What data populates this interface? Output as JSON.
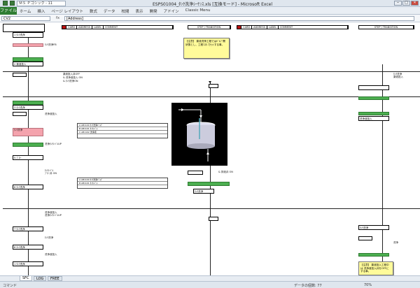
{
  "window": {
    "title": "ESPS01004_ﾀﾝｸ洗浄ｼｰｹﾝｽ.xls [互換モード] - Microsoft Excel",
    "font_box": "ＭＳ Ｐゴシック - 11",
    "controls": [
      "‒",
      "□",
      "✕"
    ]
  },
  "ribbon": {
    "file_label": "ファイル",
    "tabs": [
      "ホーム",
      "挿入",
      "ページ レイアウト",
      "数式",
      "データ",
      "校閲",
      "表示",
      "開発",
      "アドイン",
      "Classic Menu"
    ]
  },
  "formula_bar": {
    "name_box": "CV2",
    "fx": "fx",
    "formula": "[Address]"
  },
  "sheet": {
    "left_header": [
      "CARD",
      "ADDRESS",
      "LABEL",
      "COMMENT"
    ],
    "left_right_header": "STEP / TRANSITION",
    "right_header": [
      "CARD",
      "ADDRESS",
      "LABEL",
      "COMMENT"
    ],
    "right_right_header": "STEP / TRANSITION",
    "rows": [
      {
        "step": "1",
        "label": "ﾀﾝｸ洗浄"
      },
      {
        "step": "2",
        "label": "薬液投入"
      },
      {
        "step": "3",
        "label": "ﾀﾝｸ洗浄"
      },
      {
        "step": "4",
        "label": "ﾀﾝｸ洗浄"
      },
      {
        "step": "5",
        "label": "ﾌﾞﾛｰ"
      },
      {
        "step": "6",
        "label": "ﾀﾝｸ洗浄"
      },
      {
        "step": "7",
        "label": "ﾀﾝｸ洗浄"
      },
      {
        "step": "8",
        "label": "ﾀﾝｸ洗浄"
      }
    ],
    "labels_left": [
      "ﾀﾝｸ洗浄FB",
      "薬液投入",
      "洗浄液投入",
      "洗浄ﾀﾝｸﾚﾍﾞﾙUP",
      "洗浄液投入",
      "洗浄ﾀﾝｸﾚﾍﾞﾙUP",
      "ﾀﾝｸ洗浄",
      "ﾌﾞﾛｰ",
      "洗浄液投入",
      "ﾀﾝｸ洗浄"
    ],
    "labels_mid": [
      "薬液投入弁OFF",
      "& 洗浄液投入 ON",
      "& ﾀﾝｸ洗浄ON",
      "ﾀﾝｸﾚﾍﾞﾙ",
      "ﾌﾞﾛｰ弁 ON",
      "& 排液弁 ON",
      "ﾀﾝｸ洗浄",
      "ﾀﾝｸﾚﾍﾞﾙﾀﾞｳﾝ"
    ],
    "note_yellow": "【注意】\n薬液洗浄工程ではﾊﾞﾙﾌﾞ開状態とし、工程ﾏｽﾀ-でｾｯﾄする事。",
    "note_bottom": "【注意】\n薬液投入工程中は\n洗浄液投入弁をOFFに\nする事。",
    "table_rows": [
      [
        "A",
        "AB1100",
        "ﾀﾝｸ洗浄ﾊﾞﾙﾌﾞ"
      ],
      [
        "B",
        "AB1101",
        "ﾀﾝｸﾚﾍﾞﾙ"
      ],
      [
        "C",
        "AB1102",
        "洗浄液"
      ]
    ],
    "right_labels": [
      "ﾀﾝｸ洗浄",
      "薬液投入",
      "洗浄液投入",
      "ﾀﾝｸ洗浄",
      "ﾀﾝｸ洗浄",
      "洗浄"
    ]
  },
  "sheet_tabs": [
    "SFC",
    "LOG",
    "FREE"
  ],
  "status": {
    "mode": "コマンド",
    "count_label": "データの個数: 77",
    "zoom": "70%"
  }
}
